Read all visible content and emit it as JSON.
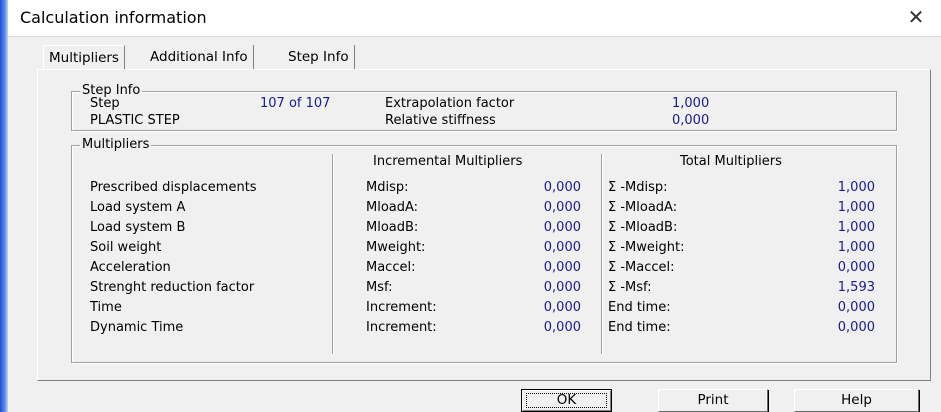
{
  "window": {
    "title": "Calculation information"
  },
  "tabs": [
    {
      "label": "Multipliers",
      "active": true
    },
    {
      "label": "Additional Info",
      "active": false
    },
    {
      "label": "Step Info",
      "active": false
    }
  ],
  "step_info": {
    "group_title": "Step Info",
    "step_label": "Step",
    "step_value": "107 of 107",
    "phase_label": "PLASTIC STEP",
    "extrapolation_label": "Extrapolation factor",
    "extrapolation_value": "1,000",
    "stiffness_label": "Relative stiffness",
    "stiffness_value": "0,000"
  },
  "multipliers": {
    "group_title": "Multipliers",
    "incremental_header": "Incremental Multipliers",
    "total_header": "Total Multipliers",
    "rows": [
      {
        "label": "Prescribed displacements",
        "inc_name": "Mdisp:",
        "inc_value": "0,000",
        "tot_name": "Σ -Mdisp:",
        "tot_value": "1,000"
      },
      {
        "label": "Load system A",
        "inc_name": "MloadA:",
        "inc_value": "0,000",
        "tot_name": "Σ -MloadA:",
        "tot_value": "1,000"
      },
      {
        "label": "Load system B",
        "inc_name": "MloadB:",
        "inc_value": "0,000",
        "tot_name": "Σ -MloadB:",
        "tot_value": "1,000"
      },
      {
        "label": "Soil weight",
        "inc_name": "Mweight:",
        "inc_value": "0,000",
        "tot_name": "Σ -Mweight:",
        "tot_value": "1,000"
      },
      {
        "label": "Acceleration",
        "inc_name": "Maccel:",
        "inc_value": "0,000",
        "tot_name": "Σ -Maccel:",
        "tot_value": "0,000"
      },
      {
        "label": "Strenght reduction factor",
        "inc_name": "Msf:",
        "inc_value": "0,000",
        "tot_name": "Σ -Msf:",
        "tot_value": "1,593"
      },
      {
        "label": "Time",
        "inc_name": "Increment:",
        "inc_value": "0,000",
        "tot_name": "End time:",
        "tot_value": "0,000"
      },
      {
        "label": "Dynamic Time",
        "inc_name": "Increment:",
        "inc_value": "0,000",
        "tot_name": "End time:",
        "tot_value": "0,000"
      }
    ]
  },
  "buttons": {
    "ok": "OK",
    "print": "Print",
    "help": "Help"
  },
  "colors": {
    "value_text": "#1a1a8c",
    "window_bg": "#f0f0f0",
    "accent_edge": "#1d4fd8"
  }
}
